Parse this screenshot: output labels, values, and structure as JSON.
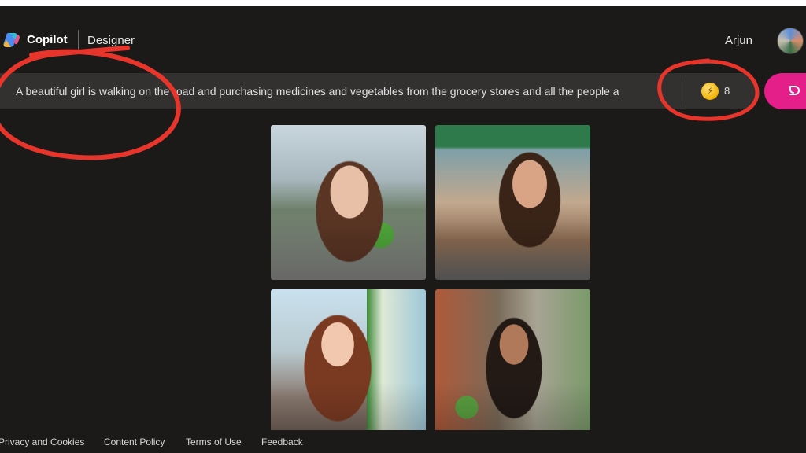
{
  "header": {
    "brand": "Copilot",
    "product": "Designer",
    "user_name": "Arjun"
  },
  "prompt": {
    "text": "A beautiful girl is walking on the road and purchasing medicines and vegetables from the grocery stores and all the people a"
  },
  "boost": {
    "count": "8"
  },
  "colors": {
    "accent": "#e51f8a",
    "background": "#1c1a19",
    "annotation": "#e8352c"
  },
  "icons": {
    "logo": "copilot-logo-icon",
    "boost": "coin-icon",
    "create": "create-icon"
  },
  "footer": {
    "links": [
      "Privacy and Cookies",
      "Content Policy",
      "Terms of Use",
      "Feedback"
    ]
  }
}
